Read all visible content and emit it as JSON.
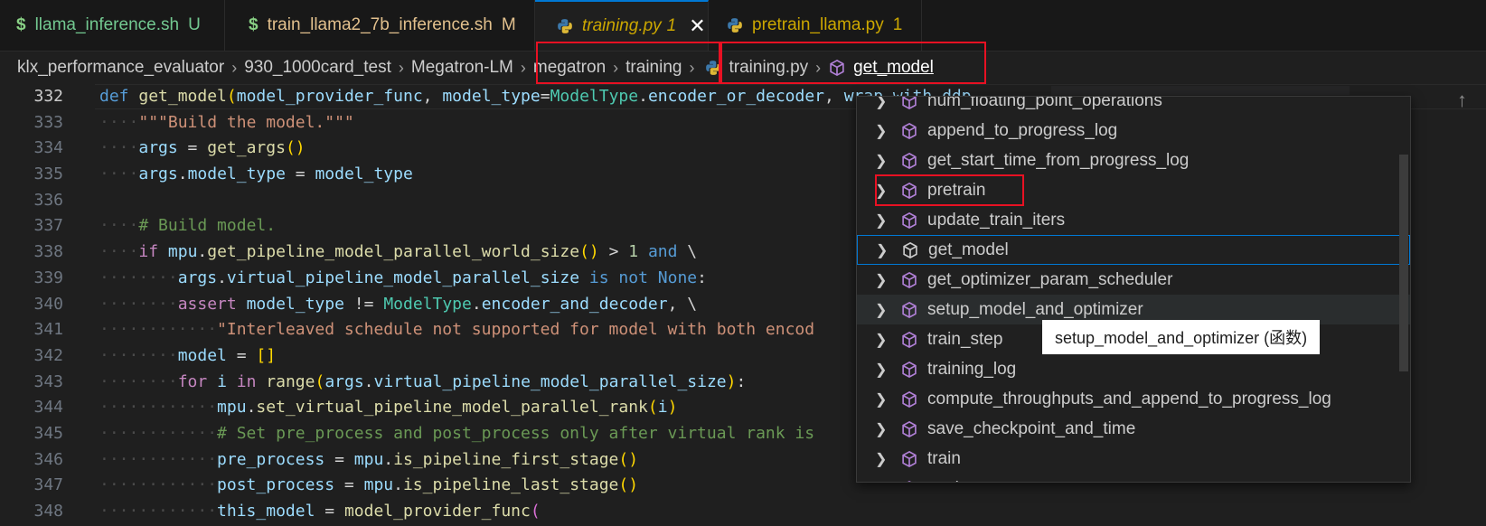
{
  "tabs": [
    {
      "icon": "$",
      "label": "llama_inference.sh",
      "status": "U"
    },
    {
      "icon": "$",
      "label": "train_llama2_7b_inference.sh",
      "status": "M"
    },
    {
      "icon": "python",
      "label": "training.py",
      "status": "1",
      "active": true
    },
    {
      "icon": "python",
      "label": "pretrain_llama.py",
      "status": "1"
    }
  ],
  "breadcrumb": [
    "klx_performance_evaluator",
    "930_1000card_test",
    "Megatron-LM",
    "megatron",
    "training",
    "training.py",
    "get_model"
  ],
  "line_numbers": [
    "332",
    "333",
    "334",
    "335",
    "336",
    "337",
    "338",
    "339",
    "340",
    "341",
    "342",
    "343",
    "344",
    "345",
    "346",
    "347",
    "348"
  ],
  "code": {
    "l332": {
      "def": "def",
      "fn": "get_model",
      "p1": "model_provider_func",
      "p2": "model_type",
      "cls": "ModelType",
      "attr": "encoder_or_decoder",
      "rest": "wrap_with_ddp"
    },
    "l333": "\"\"\"Build the model.\"\"\"",
    "l334": {
      "a": "args",
      "fn": "get_args"
    },
    "l335": {
      "a": "args",
      "b": "model_type",
      "c": "model_type"
    },
    "l337": "# Build model.",
    "l338": {
      "if": "if",
      "mpu": "mpu",
      "fn": "get_pipeline_model_parallel_world_size",
      "num": "1",
      "and": "and"
    },
    "l339": {
      "a": "args",
      "b": "virtual_pipeline_model_parallel_size",
      "is": "is",
      "not": "not",
      "none": "None"
    },
    "l340": {
      "assert": "assert",
      "a": "model_type",
      "cls": "ModelType",
      "b": "encoder_and_decoder"
    },
    "l341": "\"Interleaved schedule not supported for model with both encod",
    "l342": {
      "a": "model"
    },
    "l343": {
      "for": "for",
      "i": "i",
      "in": "in",
      "range": "range",
      "a": "args",
      "b": "virtual_pipeline_model_parallel_size"
    },
    "l344": {
      "mpu": "mpu",
      "fn": "set_virtual_pipeline_model_parallel_rank",
      "i": "i"
    },
    "l345": "# Set pre_process and post_process only after virtual rank is",
    "l346": {
      "a": "pre_process",
      "mpu": "mpu",
      "fn": "is_pipeline_first_stage"
    },
    "l347": {
      "a": "post_process",
      "mpu": "mpu",
      "fn": "is_pipeline_last_stage"
    },
    "l348": {
      "a": "this_model",
      "fn": "model_provider_func"
    }
  },
  "outline": [
    "num_floating_point_operations",
    "append_to_progress_log",
    "get_start_time_from_progress_log",
    "pretrain",
    "update_train_iters",
    "get_model",
    "get_optimizer_param_scheduler",
    "setup_model_and_optimizer",
    "train_step",
    "training_log",
    "compute_throughputs_and_append_to_progress_log",
    "save_checkpoint_and_time",
    "train",
    "evaluate"
  ],
  "tooltip": "setup_model_and_optimizer (函数)",
  "colors": {
    "accent": "#0078d4",
    "highlight_box": "#e81123",
    "symbol_icon": "#b180d7"
  }
}
